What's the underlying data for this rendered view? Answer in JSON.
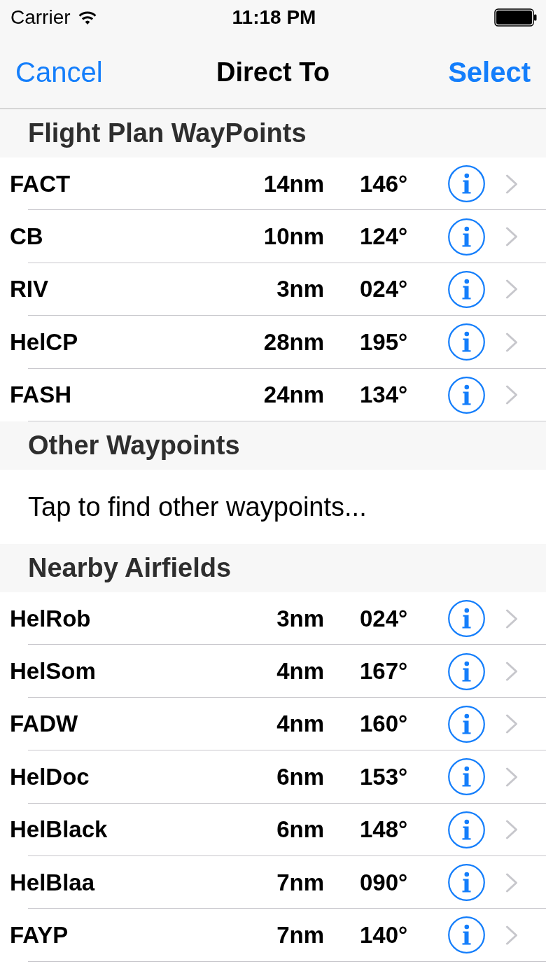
{
  "status_bar": {
    "carrier": "Carrier",
    "time": "11:18 PM"
  },
  "nav_bar": {
    "left_button": "Cancel",
    "title": "Direct To",
    "right_button": "Select"
  },
  "sections": [
    {
      "kind": "waypoints",
      "title": "Flight Plan WayPoints",
      "rows": [
        {
          "name": "FACT",
          "distance": "14nm",
          "bearing": "146°"
        },
        {
          "name": "CB",
          "distance": "10nm",
          "bearing": "124°"
        },
        {
          "name": "RIV",
          "distance": "3nm",
          "bearing": "024°"
        },
        {
          "name": "HelCP",
          "distance": "28nm",
          "bearing": "195°"
        },
        {
          "name": "FASH",
          "distance": "24nm",
          "bearing": "134°"
        }
      ]
    },
    {
      "kind": "action",
      "title": "Other Waypoints",
      "rows": [
        {
          "label": "Tap to find other waypoints..."
        }
      ]
    },
    {
      "kind": "waypoints",
      "title": "Nearby Airfields",
      "rows": [
        {
          "name": "HelRob",
          "distance": "3nm",
          "bearing": "024°"
        },
        {
          "name": "HelSom",
          "distance": "4nm",
          "bearing": "167°"
        },
        {
          "name": "FADW",
          "distance": "4nm",
          "bearing": "160°"
        },
        {
          "name": "HelDoc",
          "distance": "6nm",
          "bearing": "153°"
        },
        {
          "name": "HelBlack",
          "distance": "6nm",
          "bearing": "148°"
        },
        {
          "name": "HelBlaa",
          "distance": "7nm",
          "bearing": "090°"
        },
        {
          "name": "FAYP",
          "distance": "7nm",
          "bearing": "140°"
        }
      ]
    }
  ]
}
